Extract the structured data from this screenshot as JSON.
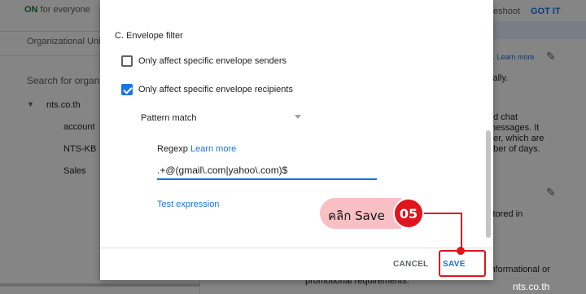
{
  "background": {
    "status_on": "ON",
    "status_rest": " for everyone",
    "troubleshoot_fragment": "eshoot",
    "got_it": "GOT IT",
    "org_units_label": "Organizational Units",
    "search_placeholder": "Search for organizational units",
    "tree_root": "nts.co.th",
    "tree_children": [
      "account",
      "NTS-KB",
      "Sales"
    ],
    "right_fragments": {
      "learn_more_prefix": "rs.",
      "learn_more": "Learn more",
      "line_ically": "cally.",
      "line_chat": "nd chat",
      "line_messages": "messages. It",
      "line_der": "der, which are",
      "line_days": "nber of days.",
      "line_stored": "stored in",
      "line_informational": "informational or",
      "line_promotional": "promotional requirements."
    }
  },
  "dialog": {
    "section_title": "C. Envelope filter",
    "option_senders": {
      "label": "Only affect specific envelope senders",
      "checked": false
    },
    "option_recipients": {
      "label": "Only affect specific envelope recipients",
      "checked": true
    },
    "match_type": "Pattern match",
    "regexp_label": "Regexp",
    "learn_more": "Learn more",
    "regexp_value": ".+@(gmail\\.com|yahoo\\.com)$",
    "test_expression": "Test expression",
    "cancel_label": "CANCEL",
    "save_label": "SAVE"
  },
  "annotation": {
    "callout_text": "คลิก Save",
    "step_number": "05",
    "accent_color": "#e0141c",
    "callout_color": "#f8c0c4"
  },
  "watermark": "nts.co.th"
}
